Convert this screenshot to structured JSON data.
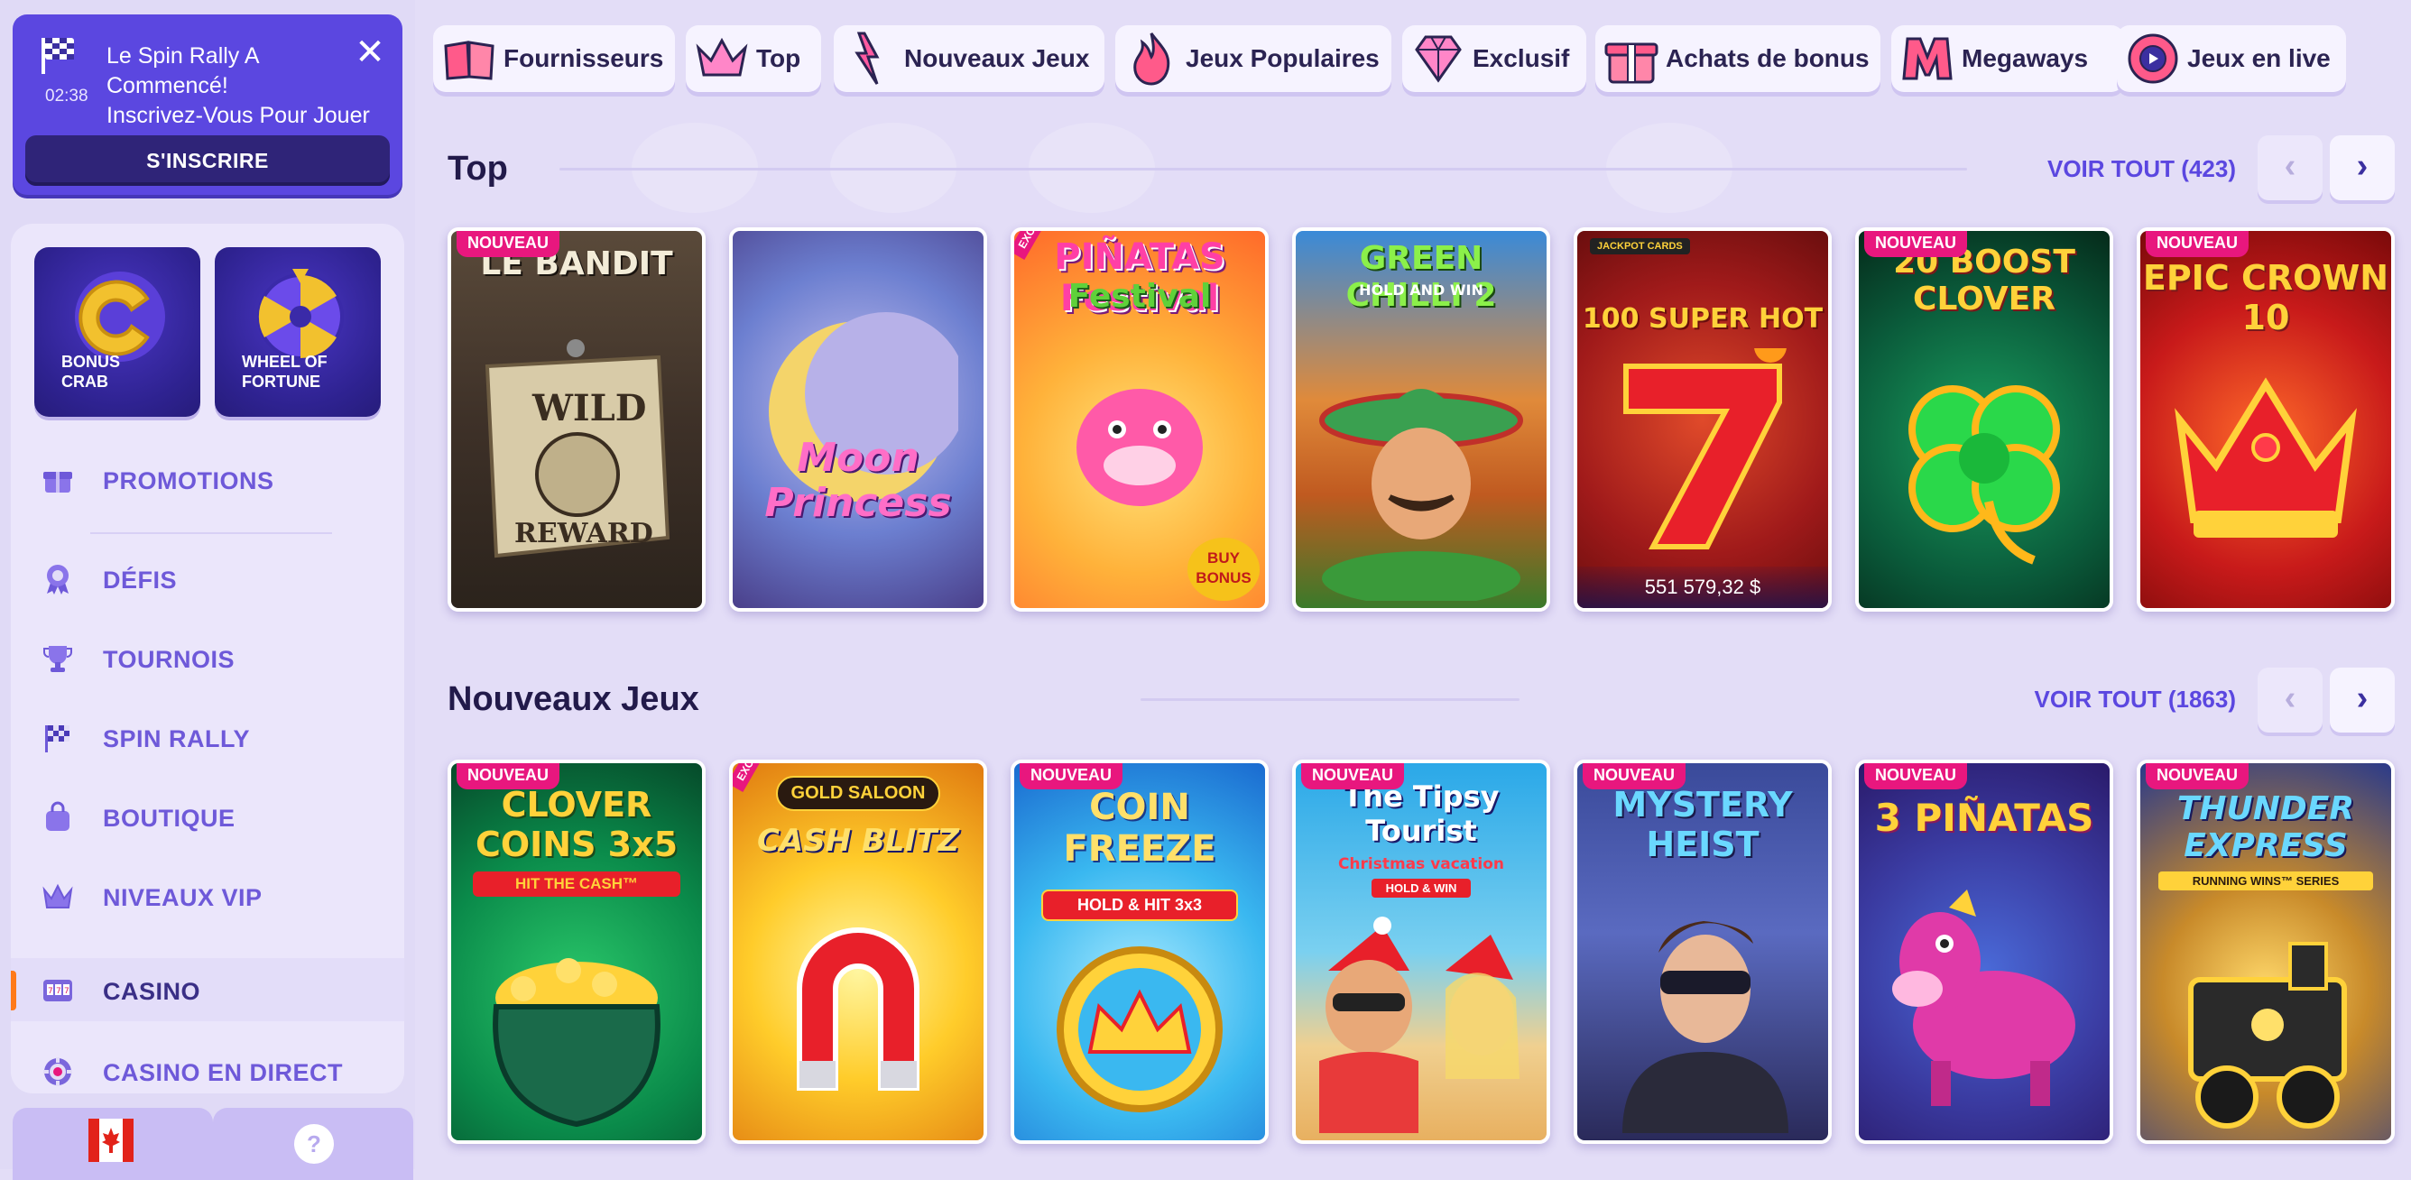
{
  "promo": {
    "text": "Le Spin Rally A Commencé! Inscrivez-Vous Pour Jouer",
    "line1": "Le Spin Rally A",
    "line2": "Commencé!",
    "line3": "Inscrivez-Vous Pour Jouer",
    "timer": "02:38",
    "button": "S'INSCRIRE"
  },
  "tiles": [
    {
      "label1": "BONUS",
      "label2": "CRAB"
    },
    {
      "label1": "WHEEL OF",
      "label2": "FORTUNE"
    }
  ],
  "nav": [
    {
      "label": "PROMOTIONS",
      "icon": "gift-icon"
    },
    {
      "label": "DÉFIS",
      "icon": "medal-icon"
    },
    {
      "label": "TOURNOIS",
      "icon": "trophy-icon"
    },
    {
      "label": "SPIN RALLY",
      "icon": "checkered-flag-icon"
    },
    {
      "label": "BOUTIQUE",
      "icon": "shopping-bag-icon"
    },
    {
      "label": "NIVEAUX VIP",
      "icon": "crown-icon"
    },
    {
      "label": "CASINO",
      "icon": "casino-icon",
      "active": true
    },
    {
      "label": "CASINO EN DIRECT",
      "icon": "live-chip-icon"
    }
  ],
  "bottom": {
    "help": "?"
  },
  "categories": [
    {
      "label": "Fournisseurs",
      "icon": "book-icon"
    },
    {
      "label": "Top",
      "icon": "crown-icon"
    },
    {
      "label": "Nouveaux Jeux",
      "icon": "lightning-icon"
    },
    {
      "label": "Jeux Populaires",
      "icon": "flame-icon"
    },
    {
      "label": "Exclusif",
      "icon": "diamond-icon"
    },
    {
      "label": "Achats de bonus",
      "icon": "gift-icon"
    },
    {
      "label": "Megaways",
      "icon": "m-icon"
    },
    {
      "label": "Jeux en live",
      "icon": "chip-icon"
    }
  ],
  "sections": [
    {
      "title": "Top",
      "voir": "VOIR TOUT (423)",
      "games": [
        {
          "title": "LE BANDIT",
          "badge": "NOUVEAU"
        },
        {
          "title": "Moon Princess",
          "badge": ""
        },
        {
          "title": "PIÑATAS Festival",
          "badge": "EXCLUSIVE"
        },
        {
          "title": "GREEN CHILLI 2",
          "badge": ""
        },
        {
          "title": "100 SUPER HOT",
          "badge": "",
          "jackpot": "551 579,32 $"
        },
        {
          "title": "20 BOOST CLOVER",
          "badge": "NOUVEAU"
        },
        {
          "title": "EPIC CROWN 10",
          "badge": "NOUVEAU"
        }
      ]
    },
    {
      "title": "Nouveaux Jeux",
      "voir": "VOIR TOUT (1863)",
      "games": [
        {
          "title": "CLOVER COINS 3x5",
          "badge": "NOUVEAU"
        },
        {
          "title": "CASH BLITZ",
          "badge": "EXCLUSIVE"
        },
        {
          "title": "COIN FREEZE",
          "badge": "NOUVEAU"
        },
        {
          "title": "The Tipsy Tourist",
          "badge": "NOUVEAU"
        },
        {
          "title": "MYSTERY HEIST",
          "badge": "NOUVEAU"
        },
        {
          "title": "3 PIÑATAS",
          "badge": "NOUVEAU"
        },
        {
          "title": "THUNDER EXPRESS",
          "badge": "NOUVEAU"
        }
      ]
    }
  ],
  "game_subtitles": {
    "moon": "Moon",
    "princess": "Princess",
    "festival": "Festival",
    "hold_and_win": "HOLD AND WIN",
    "jackpot_cards": "JACKPOT CARDS",
    "hit_the_cash": "HIT THE CASH™",
    "gold_saloon": "GOLD SALOON",
    "hold_hit": "HOLD & HIT 3x3",
    "christmas_vacation": "Christmas vacation",
    "hold_win": "HOLD & WIN",
    "running_wins": "RUNNING WINS™ SERIES",
    "wild": "WILD",
    "reward": "REWARD",
    "buy_bonus": "BUY BONUS"
  }
}
